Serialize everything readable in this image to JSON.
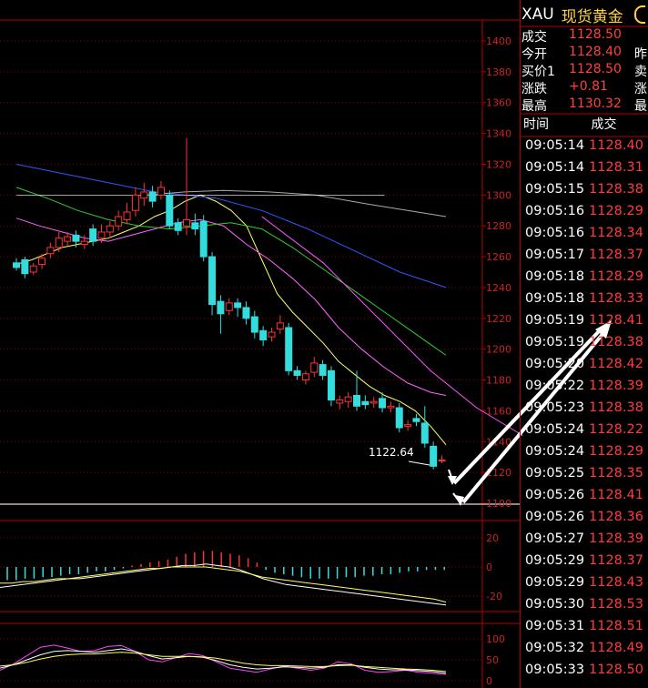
{
  "header": {
    "symbol": "XAU",
    "name": "现货黄金"
  },
  "quote": [
    {
      "label": "成交",
      "value": "1128.50",
      "extra": ""
    },
    {
      "label": "今开",
      "value": "1128.40",
      "extra": "昨"
    },
    {
      "label": "买价1",
      "value": "1128.50",
      "extra": "卖"
    },
    {
      "label": "涨跌",
      "value": "+0.81",
      "extra": "涨"
    },
    {
      "label": "最高",
      "value": "1130.32",
      "extra": "最"
    }
  ],
  "ticks_header": {
    "time": "时间",
    "price": "成交"
  },
  "ticks": [
    {
      "time": "09:05:14",
      "price": "1128.40"
    },
    {
      "time": "09:05:14",
      "price": "1128.31"
    },
    {
      "time": "09:05:15",
      "price": "1128.38"
    },
    {
      "time": "09:05:16",
      "price": "1128.29"
    },
    {
      "time": "09:05:16",
      "price": "1128.34"
    },
    {
      "time": "09:05:17",
      "price": "1128.37"
    },
    {
      "time": "09:05:18",
      "price": "1128.29"
    },
    {
      "time": "09:05:18",
      "price": "1128.33"
    },
    {
      "time": "09:05:19",
      "price": "1128.41"
    },
    {
      "time": "09:05:19",
      "price": "1128.38"
    },
    {
      "time": "09:05:20",
      "price": "1128.42"
    },
    {
      "time": "09:05:22",
      "price": "1128.39"
    },
    {
      "time": "09:05:23",
      "price": "1128.38"
    },
    {
      "time": "09:05:24",
      "price": "1128.22"
    },
    {
      "time": "09:05:24",
      "price": "1128.29"
    },
    {
      "time": "09:05:25",
      "price": "1128.35"
    },
    {
      "time": "09:05:26",
      "price": "1128.41"
    },
    {
      "time": "09:05:26",
      "price": "1128.36"
    },
    {
      "time": "09:05:27",
      "price": "1128.39"
    },
    {
      "time": "09:05:29",
      "price": "1128.37"
    },
    {
      "time": "09:05:29",
      "price": "1128.43"
    },
    {
      "time": "09:05:30",
      "price": "1128.53"
    },
    {
      "time": "09:05:31",
      "price": "1128.51"
    },
    {
      "time": "09:05:32",
      "price": "1128.49"
    },
    {
      "time": "09:05:33",
      "price": "1128.50"
    }
  ],
  "chart_data": [
    {
      "type": "candlestick",
      "y_axis_labels": [
        "1400",
        "1380",
        "1360",
        "1340",
        "1320",
        "1300",
        "1280",
        "1260",
        "1240",
        "1220",
        "1200",
        "1180",
        "1160",
        "1140",
        "1120",
        "1100"
      ],
      "ylim": [
        1100,
        1400
      ],
      "annotation": "1122.64",
      "candles": [
        {
          "o": 1256,
          "c": 1253,
          "h": 1259,
          "l": 1251
        },
        {
          "o": 1258,
          "c": 1249,
          "h": 1260,
          "l": 1246
        },
        {
          "o": 1250,
          "c": 1254,
          "h": 1256,
          "l": 1248
        },
        {
          "o": 1255,
          "c": 1259,
          "h": 1262,
          "l": 1252
        },
        {
          "o": 1262,
          "c": 1266,
          "h": 1269,
          "l": 1259
        },
        {
          "o": 1266,
          "c": 1272,
          "h": 1276,
          "l": 1263
        },
        {
          "o": 1270,
          "c": 1273,
          "h": 1276,
          "l": 1267
        },
        {
          "o": 1274,
          "c": 1270,
          "h": 1277,
          "l": 1266
        },
        {
          "o": 1268,
          "c": 1270,
          "h": 1274,
          "l": 1265
        },
        {
          "o": 1278,
          "c": 1270,
          "h": 1281,
          "l": 1267
        },
        {
          "o": 1272,
          "c": 1276,
          "h": 1281,
          "l": 1269
        },
        {
          "o": 1276,
          "c": 1280,
          "h": 1283,
          "l": 1272
        },
        {
          "o": 1280,
          "c": 1286,
          "h": 1290,
          "l": 1277
        },
        {
          "o": 1284,
          "c": 1289,
          "h": 1295,
          "l": 1281
        },
        {
          "o": 1290,
          "c": 1300,
          "h": 1305,
          "l": 1286
        },
        {
          "o": 1298,
          "c": 1302,
          "h": 1308,
          "l": 1293
        },
        {
          "o": 1302,
          "c": 1296,
          "h": 1306,
          "l": 1292
        },
        {
          "o": 1300,
          "c": 1305,
          "h": 1309,
          "l": 1297
        },
        {
          "o": 1300,
          "c": 1280,
          "h": 1303,
          "l": 1278
        },
        {
          "o": 1282,
          "c": 1277,
          "h": 1285,
          "l": 1274
        },
        {
          "o": 1280,
          "c": 1284,
          "h": 1337,
          "l": 1274
        },
        {
          "o": 1282,
          "c": 1278,
          "h": 1288,
          "l": 1274
        },
        {
          "o": 1283,
          "c": 1260,
          "h": 1287,
          "l": 1257
        },
        {
          "o": 1260,
          "c": 1229,
          "h": 1263,
          "l": 1222
        },
        {
          "o": 1231,
          "c": 1223,
          "h": 1235,
          "l": 1210
        },
        {
          "o": 1225,
          "c": 1230,
          "h": 1233,
          "l": 1222
        },
        {
          "o": 1230,
          "c": 1227,
          "h": 1233,
          "l": 1221
        },
        {
          "o": 1227,
          "c": 1220,
          "h": 1231,
          "l": 1216
        },
        {
          "o": 1221,
          "c": 1211,
          "h": 1225,
          "l": 1207
        },
        {
          "o": 1212,
          "c": 1206,
          "h": 1215,
          "l": 1202
        },
        {
          "o": 1208,
          "c": 1211,
          "h": 1214,
          "l": 1205
        },
        {
          "o": 1213,
          "c": 1217,
          "h": 1222,
          "l": 1210
        },
        {
          "o": 1214,
          "c": 1186,
          "h": 1217,
          "l": 1183
        },
        {
          "o": 1186,
          "c": 1183,
          "h": 1189,
          "l": 1180
        },
        {
          "o": 1180,
          "c": 1184,
          "h": 1186,
          "l": 1177
        },
        {
          "o": 1185,
          "c": 1191,
          "h": 1195,
          "l": 1182
        },
        {
          "o": 1190,
          "c": 1183,
          "h": 1193,
          "l": 1180
        },
        {
          "o": 1186,
          "c": 1167,
          "h": 1189,
          "l": 1163
        },
        {
          "o": 1165,
          "c": 1167,
          "h": 1170,
          "l": 1161
        },
        {
          "o": 1166,
          "c": 1169,
          "h": 1172,
          "l": 1162
        },
        {
          "o": 1170,
          "c": 1163,
          "h": 1186,
          "l": 1160
        },
        {
          "o": 1166,
          "c": 1164,
          "h": 1170,
          "l": 1161
        },
        {
          "o": 1165,
          "c": 1166,
          "h": 1169,
          "l": 1162
        },
        {
          "o": 1168,
          "c": 1162,
          "h": 1172,
          "l": 1159
        },
        {
          "o": 1162,
          "c": 1163,
          "h": 1166,
          "l": 1159
        },
        {
          "o": 1162,
          "c": 1149,
          "h": 1165,
          "l": 1146
        },
        {
          "o": 1150,
          "c": 1151,
          "h": 1154,
          "l": 1147
        },
        {
          "o": 1155,
          "c": 1153,
          "h": 1158,
          "l": 1150
        },
        {
          "o": 1152,
          "c": 1139,
          "h": 1163,
          "l": 1136
        },
        {
          "o": 1137,
          "c": 1124,
          "h": 1140,
          "l": 1122
        },
        {
          "o": 1128,
          "c": 1128,
          "h": 1131,
          "l": 1126
        }
      ],
      "ma_lines": [
        {
          "color": "#ffff66",
          "pts": [
            [
              1255,
              0
            ],
            [
              1258,
              10
            ],
            [
              1262,
              20
            ],
            [
              1266,
              30
            ],
            [
              1268,
              40
            ],
            [
              1270,
              50
            ],
            [
              1272,
              60
            ],
            [
              1276,
              70
            ],
            [
              1280,
              80
            ],
            [
              1286,
              90
            ],
            [
              1290,
              100
            ],
            [
              1296,
              110
            ],
            [
              1300,
              120
            ],
            [
              1296,
              130
            ],
            [
              1290,
              140
            ],
            [
              1280,
              150
            ],
            [
              1258,
              160
            ],
            [
              1236,
              170
            ],
            [
              1224,
              180
            ],
            [
              1214,
              190
            ],
            [
              1204,
              200
            ],
            [
              1192,
              210
            ],
            [
              1184,
              220
            ],
            [
              1176,
              230
            ],
            [
              1170,
              240
            ],
            [
              1166,
              250
            ],
            [
              1160,
              260
            ],
            [
              1150,
              270
            ],
            [
              1138,
              280
            ]
          ]
        },
        {
          "color": "#ff66ff",
          "pts": [
            [
              1285,
              0
            ],
            [
              1280,
              15
            ],
            [
              1276,
              30
            ],
            [
              1272,
              45
            ],
            [
              1270,
              60
            ],
            [
              1274,
              75
            ],
            [
              1278,
              90
            ],
            [
              1282,
              105
            ],
            [
              1284,
              120
            ],
            [
              1280,
              135
            ],
            [
              1268,
              150
            ],
            [
              1258,
              165
            ],
            [
              1246,
              180
            ],
            [
              1232,
              195
            ],
            [
              1214,
              210
            ],
            [
              1200,
              225
            ],
            [
              1188,
              240
            ],
            [
              1178,
              255
            ],
            [
              1172,
              270
            ],
            [
              1170,
              280
            ]
          ]
        },
        {
          "color": "#33cc33",
          "pts": [
            [
              1305,
              0
            ],
            [
              1298,
              20
            ],
            [
              1290,
              40
            ],
            [
              1284,
              60
            ],
            [
              1280,
              80
            ],
            [
              1278,
              100
            ],
            [
              1280,
              120
            ],
            [
              1282,
              140
            ],
            [
              1278,
              160
            ],
            [
              1266,
              180
            ],
            [
              1252,
              200
            ],
            [
              1238,
              220
            ],
            [
              1224,
              240
            ],
            [
              1210,
              260
            ],
            [
              1196,
              280
            ]
          ]
        },
        {
          "color": "#3355ff",
          "pts": [
            [
              1320,
              0
            ],
            [
              1314,
              30
            ],
            [
              1308,
              60
            ],
            [
              1302,
              90
            ],
            [
              1300,
              110
            ],
            [
              1298,
              130
            ],
            [
              1290,
              160
            ],
            [
              1278,
              190
            ],
            [
              1264,
              220
            ],
            [
              1250,
              250
            ],
            [
              1240,
              280
            ]
          ]
        },
        {
          "color": "#aaaaaa",
          "pts": [
            [
              1300,
              85
            ],
            [
              1302,
              110
            ],
            [
              1303,
              135
            ],
            [
              1302,
              165
            ],
            [
              1300,
              195
            ],
            [
              1294,
              230
            ],
            [
              1286,
              280
            ]
          ]
        },
        {
          "color": "#ff55ff",
          "pts": [
            [
              1286,
              160
            ],
            [
              1256,
              200
            ],
            [
              1216,
              240
            ],
            [
              1186,
              270
            ],
            [
              1162,
              300
            ],
            [
              1144,
              330
            ]
          ]
        },
        {
          "color": "#ffffff",
          "pts": [
            [
              1300,
              0
            ],
            [
              1300,
              240
            ]
          ]
        }
      ]
    },
    {
      "type": "bar",
      "y_axis_labels": [
        "20",
        "0",
        "-20"
      ],
      "ylim": [
        -28,
        28
      ],
      "hist": [
        -9,
        -9,
        -8,
        -8,
        -7,
        -7,
        -6,
        -5,
        -5,
        -4,
        -3,
        -3,
        -2,
        -1,
        1,
        2,
        3,
        4,
        5,
        7,
        9,
        10,
        11,
        11,
        10,
        9,
        8,
        6,
        3,
        -2,
        -4,
        -5,
        -6,
        -7,
        -8,
        -8,
        -8,
        -8,
        -7,
        -7,
        -6,
        -6,
        -5,
        -5,
        -4,
        -3,
        -3,
        -2,
        -2,
        -2
      ],
      "lines": [
        {
          "color": "#ffffff",
          "values": [
            -14,
            -13,
            -12,
            -11,
            -10,
            -9,
            -8,
            -8,
            -7,
            -6,
            -5,
            -4,
            -3,
            -2,
            -1,
            0,
            1,
            1,
            2,
            1,
            0,
            -2,
            -5,
            -8,
            -10,
            -12,
            -13,
            -14,
            -15,
            -16,
            -17,
            -18,
            -19,
            -20,
            -21,
            -22,
            -23,
            -24,
            -25,
            -26
          ]
        },
        {
          "color": "#ffff66",
          "values": [
            -11,
            -11,
            -10,
            -10,
            -9,
            -8,
            -8,
            -7,
            -6,
            -5,
            -4,
            -3,
            -2,
            -1,
            -1,
            0,
            0,
            0,
            0,
            -1,
            -2,
            -3,
            -5,
            -7,
            -8,
            -9,
            -10,
            -11,
            -12,
            -13,
            -14,
            -15,
            -16,
            -17,
            -18,
            -19,
            -20,
            -21,
            -22,
            -24
          ]
        }
      ]
    },
    {
      "type": "line",
      "y_axis_labels": [
        "100",
        "50",
        "0"
      ],
      "ylim": [
        0,
        100
      ],
      "lines": [
        {
          "color": "#ff44ff",
          "values": [
            25,
            40,
            60,
            80,
            85,
            78,
            70,
            72,
            82,
            84,
            70,
            50,
            45,
            55,
            65,
            60,
            45,
            30,
            25,
            20,
            28,
            35,
            30,
            25,
            30,
            45,
            40,
            25,
            20,
            22,
            25,
            20,
            18,
            15
          ]
        },
        {
          "color": "#ffffff",
          "values": [
            30,
            38,
            50,
            62,
            70,
            72,
            70,
            68,
            72,
            76,
            70,
            60,
            52,
            55,
            58,
            56,
            48,
            38,
            32,
            28,
            30,
            33,
            32,
            30,
            32,
            38,
            38,
            32,
            28,
            26,
            26,
            24,
            22,
            18
          ]
        },
        {
          "color": "#ffff66",
          "values": [
            35,
            38,
            44,
            52,
            58,
            62,
            64,
            64,
            66,
            68,
            66,
            62,
            58,
            58,
            58,
            57,
            54,
            48,
            42,
            38,
            36,
            36,
            35,
            34,
            34,
            36,
            37,
            34,
            32,
            30,
            28,
            27,
            25,
            22
          ]
        }
      ]
    }
  ]
}
